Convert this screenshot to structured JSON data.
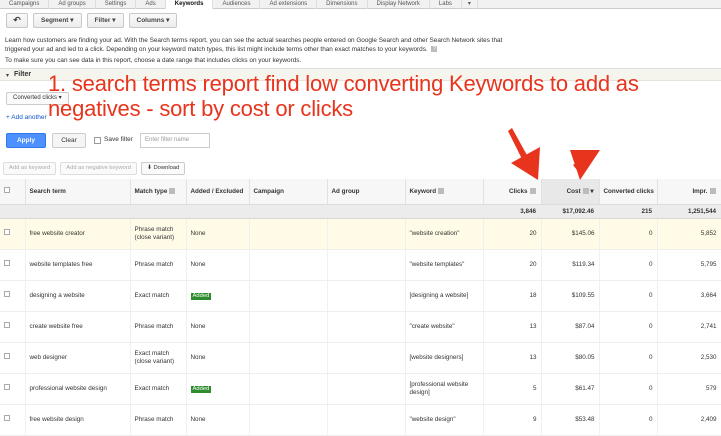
{
  "tabs": [
    "Campaigns",
    "Ad groups",
    "Settings",
    "Ads",
    "Keywords",
    "Audiences",
    "Ad extensions",
    "Dimensions",
    "Display Network",
    "Labs",
    "▾"
  ],
  "toolbar": {
    "back_icon": "↶",
    "segment": "Segment ▾",
    "filter": "Filter ▾",
    "columns": "Columns ▾"
  },
  "description": {
    "text": "Learn how customers are finding your ad. With the Search terms report, you can see the actual searches people entered on Google Search and other Search Network sites that triggered your ad and led to a click. Depending on your keyword match types, this list might include terms other than exact matches to your keywords.",
    "help": "?",
    "line2": "To make sure you can see data in this report, choose a date range that includes clicks on your keywords."
  },
  "filter": {
    "toggle": "▾",
    "label": "Filter",
    "condition": "Converted clicks ▾",
    "add_another": "+ Add another",
    "apply": "Apply",
    "clear": "Clear",
    "save_filter": "Save filter",
    "filter_name_placeholder": "Enter filter name"
  },
  "actions": {
    "add_keyword": "Add as keyword",
    "add_negative": "Add as negative keyword",
    "download": "⬇ Download"
  },
  "overlay_text": {
    "line1": "1. search terms report find low converting Keywords to add as",
    "line2": "negatives - sort by cost or clicks"
  },
  "table": {
    "headers": {
      "search_term": "Search term",
      "match_type": "Match type",
      "added": "Added / Excluded",
      "campaign": "Campaign",
      "ad_group": "Ad group",
      "keyword": "Keyword",
      "clicks": "Clicks",
      "cost": "Cost",
      "cost_sort": "▾",
      "conv": "Converted clicks",
      "impr": "Impr."
    },
    "total": {
      "clicks": "3,846",
      "cost": "$17,092.46",
      "conv": "215",
      "impr": "1,251,544"
    },
    "rows": [
      {
        "term": "free website creator",
        "match": "Phrase match (close variant)",
        "added": "None",
        "added_badge": false,
        "keyword": "\"website creation\"",
        "clicks": "20",
        "cost": "$145.06",
        "conv": "0",
        "impr": "5,852"
      },
      {
        "term": "website templates free",
        "match": "Phrase match",
        "added": "None",
        "added_badge": false,
        "keyword": "\"website templates\"",
        "clicks": "20",
        "cost": "$119.34",
        "conv": "0",
        "impr": "5,795"
      },
      {
        "term": "designing a website",
        "match": "Exact match",
        "added": "Added",
        "added_badge": true,
        "keyword": "[designing a website]",
        "clicks": "18",
        "cost": "$109.55",
        "conv": "0",
        "impr": "3,664"
      },
      {
        "term": "create website free",
        "match": "Phrase match",
        "added": "None",
        "added_badge": false,
        "keyword": "\"create website\"",
        "clicks": "13",
        "cost": "$87.04",
        "conv": "0",
        "impr": "2,741"
      },
      {
        "term": "web designer",
        "match": "Exact match (close variant)",
        "added": "None",
        "added_badge": false,
        "keyword": "[website designers]",
        "clicks": "13",
        "cost": "$80.05",
        "conv": "0",
        "impr": "2,530"
      },
      {
        "term": "professional website design",
        "match": "Exact match",
        "added": "Added",
        "added_badge": true,
        "keyword": "[professional website design]",
        "clicks": "5",
        "cost": "$61.47",
        "conv": "0",
        "impr": "579"
      },
      {
        "term": "free website design",
        "match": "Phrase match",
        "added": "None",
        "added_badge": false,
        "keyword": "\"website design\"",
        "clicks": "9",
        "cost": "$53.48",
        "conv": "0",
        "impr": "2,409"
      }
    ]
  },
  "colors": {
    "overlay": "#e8341c",
    "added_badge": "#2e8b2e",
    "apply": "#4d90fe"
  }
}
